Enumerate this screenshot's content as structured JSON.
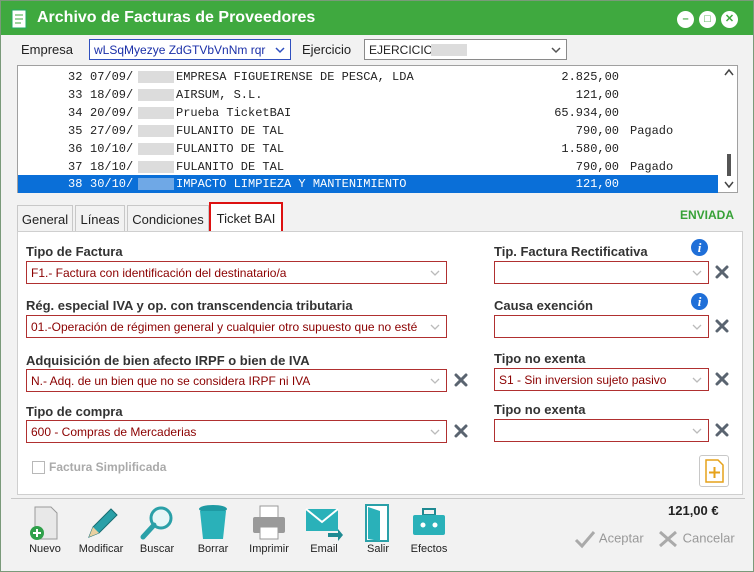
{
  "window": {
    "title": "Archivo de Facturas de Proveedores"
  },
  "header": {
    "empresa_label": "Empresa",
    "empresa_value": "wLSqMyezye ZdGTVbVnNm rqr",
    "ejercicio_label": "Ejercicio",
    "ejercicio_value": "EJERCICIO"
  },
  "invoices": [
    {
      "num": "32",
      "date": "07/09/",
      "supplier": "EMPRESA FIGUEIRENSE DE PESCA, LDA",
      "amount": "2.825,00",
      "status": ""
    },
    {
      "num": "33",
      "date": "18/09/",
      "supplier": "AIRSUM, S.L.",
      "amount": "121,00",
      "status": ""
    },
    {
      "num": "34",
      "date": "20/09/",
      "supplier": "Prueba TicketBAI",
      "amount": "65.934,00",
      "status": ""
    },
    {
      "num": "35",
      "date": "27/09/",
      "supplier": "FULANITO DE TAL",
      "amount": "790,00",
      "status": "Pagado"
    },
    {
      "num": "36",
      "date": "10/10/",
      "supplier": "FULANITO DE TAL",
      "amount": "1.580,00",
      "status": ""
    },
    {
      "num": "37",
      "date": "18/10/",
      "supplier": "FULANITO DE TAL",
      "amount": "790,00",
      "status": "Pagado"
    },
    {
      "num": "38",
      "date": "30/10/",
      "supplier": "IMPACTO LIMPIEZA Y MANTENIMIENTO",
      "amount": "121,00",
      "status": ""
    }
  ],
  "selected_row": 6,
  "tabs": [
    {
      "label": "General"
    },
    {
      "label": "Líneas"
    },
    {
      "label": "Condiciones"
    },
    {
      "label": "Ticket BAI"
    }
  ],
  "active_tab": "Ticket BAI",
  "status_text": "ENVIADA",
  "form": {
    "tipo_factura_label": "Tipo de Factura",
    "tipo_factura_value": "F1.- Factura con identificación del destinatario/a",
    "regimen_label": "Rég. especial IVA y op. con transcendencia tributaria",
    "regimen_value": "01.-Operación de régimen general y cualquier otro supuesto que no esté",
    "adquisicion_label": "Adquisición de bien afecto IRPF o bien de IVA",
    "adquisicion_value": "N.- Adq. de un bien que no se considera IRPF ni IVA",
    "tipo_compra_label": "Tipo de compra",
    "tipo_compra_value": "600 - Compras de Mercaderias",
    "rectificativa_label": "Tip. Factura Rectificativa",
    "rectificativa_value": "",
    "exencion_label": "Causa exención",
    "exencion_value": "",
    "no_exenta1_label": "Tipo no exenta",
    "no_exenta1_value": "S1 - Sin inversion sujeto pasivo",
    "no_exenta2_label": "Tipo no exenta",
    "no_exenta2_value": "",
    "simplificada_label": "Factura Simplificada",
    "simplificada_checked": false
  },
  "toolbar": {
    "nuevo": "Nuevo",
    "modificar": "Modificar",
    "buscar": "Buscar",
    "borrar": "Borrar",
    "imprimir": "Imprimir",
    "email": "Email",
    "salir": "Salir",
    "efectos": "Efectos"
  },
  "total": "121,00 €",
  "actions": {
    "aceptar": "Aceptar",
    "cancelar": "Cancelar"
  },
  "colors": {
    "titlebar": "#3fa93f",
    "selection": "#0a6fd8",
    "field_text": "#8b0000",
    "enviada": "#37a137"
  }
}
